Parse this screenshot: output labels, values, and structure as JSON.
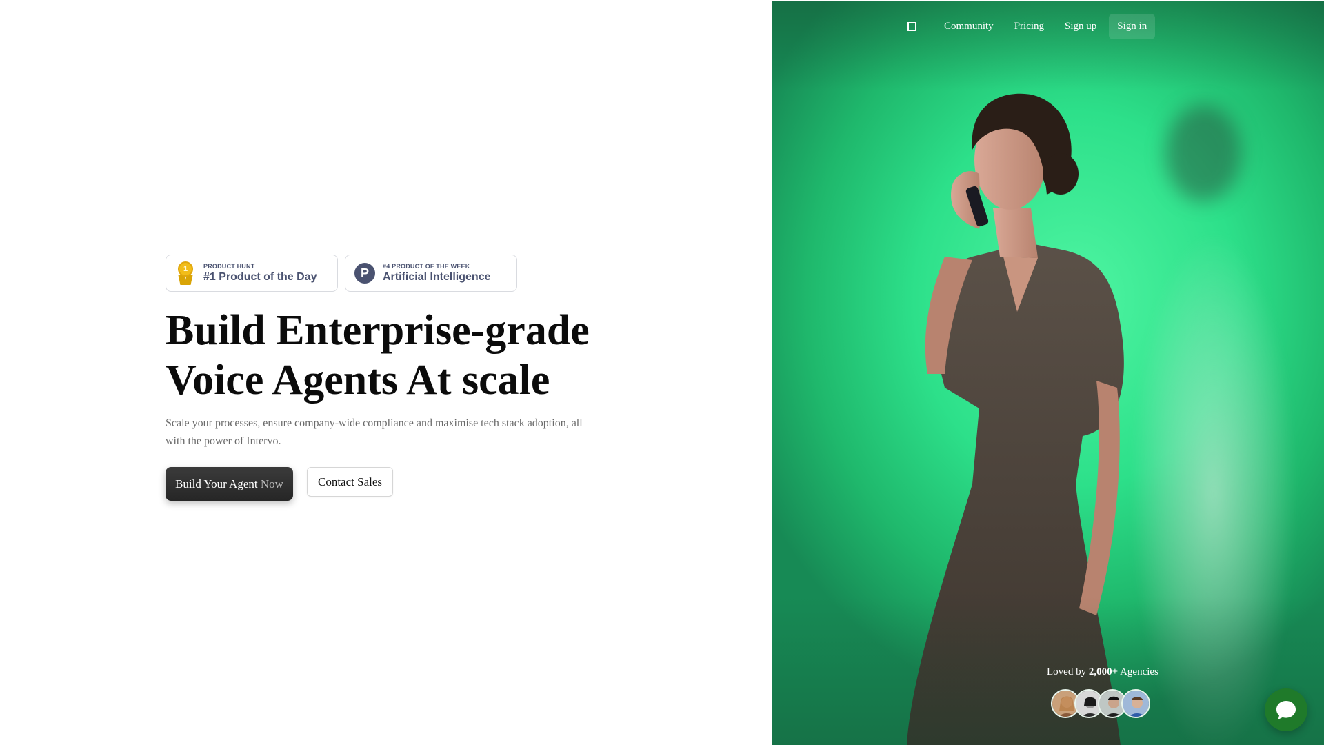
{
  "badges": [
    {
      "small": "Product Hunt",
      "big": "#1 Product of the Day",
      "icon": "medal-icon",
      "medal_text": "1"
    },
    {
      "small": "#4 Product of the Week",
      "big": "Artificial Intelligence",
      "icon": "product-hunt-logo-icon",
      "logo_letter": "P"
    }
  ],
  "headline": {
    "line1": "Build Enterprise-grade",
    "line2": "Voice Agents At scale"
  },
  "subtext": "Scale your processes, ensure company-wide compliance and maximise tech stack adoption, all with the power of Intervo.",
  "cta": {
    "primary_main": "Build Your Agent",
    "primary_dim": "Now",
    "secondary": "Contact Sales"
  },
  "nav": {
    "items": [
      "Community",
      "Pricing",
      "Sign up",
      "Sign in"
    ]
  },
  "social_proof": {
    "prefix": "Loved by",
    "count": "2,000+",
    "suffix": "Agencies"
  },
  "colors": {
    "hero_green": "#2de08a",
    "primary_button": "#2f2f2f",
    "chat_bubble": "#1f7a2a"
  }
}
